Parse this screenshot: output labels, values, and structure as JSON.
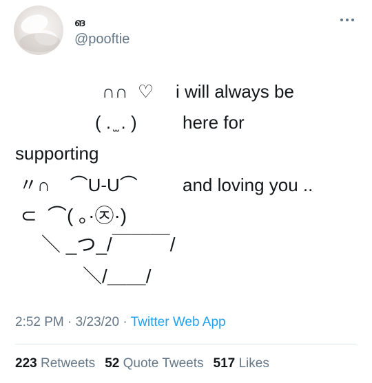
{
  "header": {
    "display_name": "ങ",
    "handle": "@pooftie",
    "more_icon": "more-horizontal-icon"
  },
  "tweet_lines": [
    {
      "left": "∩∩  ♡",
      "right": "i will always be"
    },
    {
      "left": "( . ̫ . )",
      "right": "here for"
    },
    {
      "left": "supporting",
      "right": ""
    },
    {
      "left": "〃∩    ⌒U-U⌒",
      "right": "and loving you .."
    },
    {
      "left": "⊂  ⌒( ｡·㉨·)",
      "right": ""
    },
    {
      "left": "＼ _つ_/￣￣￣/",
      "right": ""
    },
    {
      "left": "＼/＿＿/",
      "right": ""
    }
  ],
  "meta": {
    "time": "2:52 PM",
    "date": "3/23/20",
    "separator": " · ",
    "via": "Twitter Web App"
  },
  "stats": {
    "retweets_count": "223",
    "retweets_label": "Retweets",
    "quotes_count": "52",
    "quotes_label": "Quote Tweets",
    "likes_count": "517",
    "likes_label": "Likes"
  }
}
